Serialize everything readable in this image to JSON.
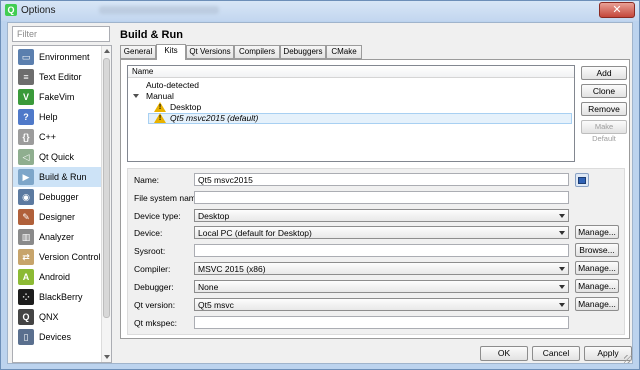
{
  "window": {
    "title": "Options"
  },
  "filter": {
    "placeholder": "Filter"
  },
  "sidebar": {
    "items": [
      {
        "label": "Environment",
        "icon": "monitor-icon"
      },
      {
        "label": "Text Editor",
        "icon": "text-editor-icon"
      },
      {
        "label": "FakeVim",
        "icon": "fakevim-icon"
      },
      {
        "label": "Help",
        "icon": "help-icon"
      },
      {
        "label": "C++",
        "icon": "cpp-icon"
      },
      {
        "label": "Qt Quick",
        "icon": "qt-quick-icon"
      },
      {
        "label": "Build & Run",
        "icon": "build-run-icon"
      },
      {
        "label": "Debugger",
        "icon": "debugger-icon"
      },
      {
        "label": "Designer",
        "icon": "designer-icon"
      },
      {
        "label": "Analyzer",
        "icon": "analyzer-icon"
      },
      {
        "label": "Version Control",
        "icon": "version-control-icon"
      },
      {
        "label": "Android",
        "icon": "android-icon"
      },
      {
        "label": "BlackBerry",
        "icon": "blackberry-icon"
      },
      {
        "label": "QNX",
        "icon": "qnx-icon"
      },
      {
        "label": "Devices",
        "icon": "devices-icon"
      }
    ],
    "selected": "Build & Run"
  },
  "page": {
    "title": "Build & Run"
  },
  "tabs": [
    "General",
    "Kits",
    "Qt Versions",
    "Compilers",
    "Debuggers",
    "CMake"
  ],
  "active_tab": "Kits",
  "tree": {
    "header": "Name",
    "auto_detected": "Auto-detected",
    "manual": "Manual",
    "kits": [
      "Desktop",
      "Qt5 msvc2015 (default)"
    ]
  },
  "side_buttons": {
    "add": "Add",
    "clone": "Clone",
    "remove": "Remove",
    "make_default": "Make Default"
  },
  "form": {
    "name": {
      "label": "Name:",
      "value": "Qt5 msvc2015"
    },
    "file_system_name": {
      "label": "File system name:",
      "value": ""
    },
    "device_type": {
      "label": "Device type:",
      "value": "Desktop"
    },
    "device": {
      "label": "Device:",
      "value": "Local PC (default for Desktop)",
      "button": "Manage..."
    },
    "sysroot": {
      "label": "Sysroot:",
      "value": "",
      "button": "Browse..."
    },
    "compiler": {
      "label": "Compiler:",
      "value": "MSVC 2015 (x86)",
      "button": "Manage..."
    },
    "debugger": {
      "label": "Debugger:",
      "value": "None",
      "button": "Manage..."
    },
    "qt_version": {
      "label": "Qt version:",
      "value": "Qt5 msvc",
      "button": "Manage..."
    },
    "qt_mkspec": {
      "label": "Qt mkspec:",
      "value": ""
    }
  },
  "dialog_buttons": {
    "ok": "OK",
    "cancel": "Cancel",
    "apply": "Apply"
  },
  "colors": {
    "selection": "#cde3f7",
    "warning": "#e9b200",
    "qt_green": "#41cd52"
  }
}
